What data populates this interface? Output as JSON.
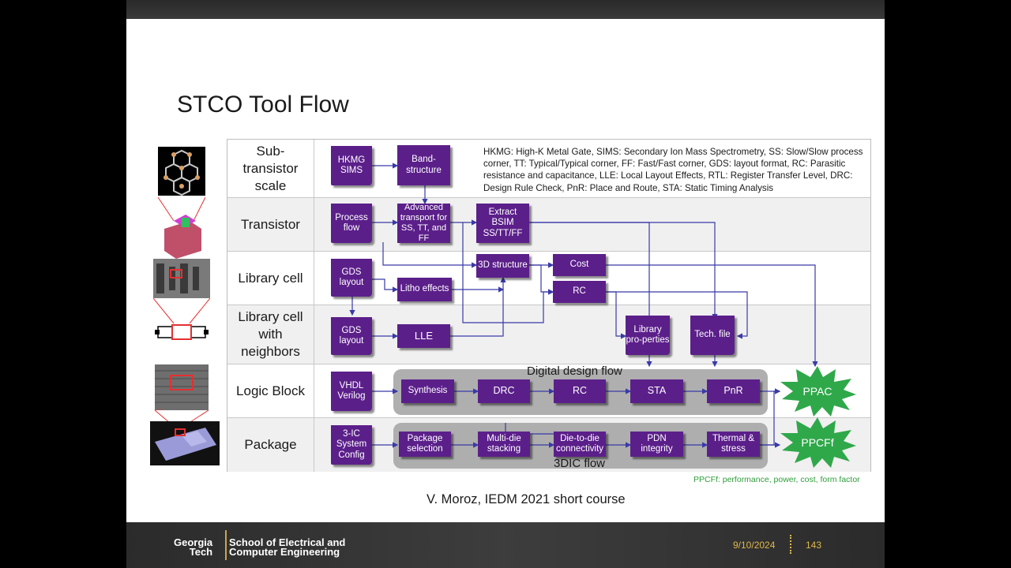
{
  "slide": {
    "title": "STCO Tool Flow",
    "abbreviations": "HKMG: High-K Metal Gate, SIMS: Secondary Ion Mass Spectrometry, SS: Slow/Slow process corner, TT: Typical/Typical corner, FF: Fast/Fast corner, GDS: layout format, RC: Parasitic resistance and capacitance, LLE: Local Layout Effects, RTL: Register Transfer Level, DRC: Design Rule Check, PnR: Place and Route, STA: Static Timing Analysis",
    "rows": [
      "Sub-transistor scale",
      "Transistor",
      "Library cell",
      "Library cell with neighbors",
      "Logic Block",
      "Package"
    ],
    "rows_display": {
      "r0a": "Sub-",
      "r0b": "transistor",
      "r0c": "scale",
      "r1": "Transistor",
      "r2": "Library cell",
      "r3a": "Library cell",
      "r3b": "with",
      "r3c": "neighbors",
      "r4": "Logic Block",
      "r5": "Package"
    },
    "boxes": {
      "hkmg": "HKMG SIMS",
      "band": "Band-structure",
      "process": "Process flow",
      "transport": "Advanced transport for SS, TT, and FF",
      "bsim": "Extract BSIM SS/TT/FF",
      "gds1": "GDS layout",
      "litho": "Litho effects",
      "struct3d": "3D structure",
      "cost": "Cost",
      "rc1": "RC",
      "gds2": "GDS layout",
      "lle": "LLE",
      "libprop": "Library pro-perties",
      "techfile": "Tech. file",
      "vhdl": "VHDL Verilog",
      "synthesis": "Synthesis",
      "drc": "DRC",
      "rc2": "RC",
      "sta": "STA",
      "pnr": "PnR",
      "ic3d": "3-IC System Config",
      "pkgsel": "Package selection",
      "multidie": "Multi-die stacking",
      "d2d": "Die-to-die connectivity",
      "pdn": "PDN integrity",
      "thermal": "Thermal & stress"
    },
    "digital_flow_label": "Digital design flow",
    "flow3dic_label": "3DIC flow",
    "ppac": "PPAC",
    "ppcff": "PPCFf",
    "ppcff_note": "PPCFf: performance,  power, cost, form factor",
    "credit": "V. Moroz, IEDM 2021 short course"
  },
  "footer": {
    "logo_line1": "Georgia",
    "logo_line2": "Tech",
    "school_line1": "School of Electrical and",
    "school_line2": "Computer Engineering",
    "date": "9/10/2024",
    "page": "143"
  },
  "colors": {
    "box": "#5b1f8a",
    "burst": "#2fa84a",
    "flow_bg": "#a6a6a6",
    "footer_accent": "#e0b84a"
  }
}
